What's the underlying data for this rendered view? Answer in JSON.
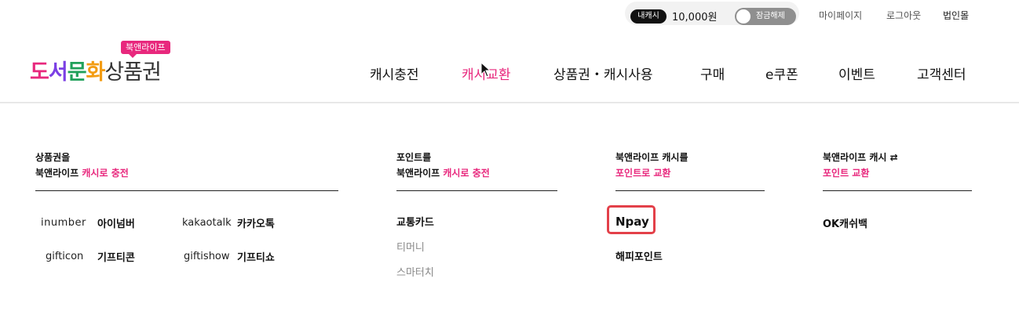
{
  "util": {
    "cash_badge": "내캐시",
    "cash_amount": "10,000원",
    "lock_label": "잠금해제",
    "links": [
      "마이페이지",
      "로그아웃",
      "법인몰"
    ]
  },
  "logo": {
    "tag": "북앤라이프",
    "word1": "도",
    "word2": "서",
    "word3": "문",
    "word4": "화",
    "word5": "상품권"
  },
  "gnb": [
    "캐시충전",
    "캐시교환",
    "상품권・캐시사용",
    "구매",
    "e쿠폰",
    "이벤트",
    "고객센터"
  ],
  "columns": {
    "col1": {
      "line1": "상품권을",
      "line2_black": "북앤라이프 ",
      "line2_pink": "캐시로 충전"
    },
    "col2": {
      "line1": "포인트를",
      "line2_black": "북앤라이프 ",
      "line2_pink": "캐시로 충전"
    },
    "col3": {
      "line1": "북앤라이프 캐시를",
      "line2_pink": "포인트로 교환"
    },
    "col4": {
      "line1": "북앤라이프 캐시 ⇄",
      "line2_pink": "포인트 교환"
    }
  },
  "col1_items": [
    {
      "logo": "inumber",
      "name": "아이넘버"
    },
    {
      "logo": "kakaotalk",
      "name": "카카오톡"
    },
    {
      "logo": "gifticon",
      "name": "기프티콘"
    },
    {
      "logo": "giftishow",
      "name": "기프티쇼"
    }
  ],
  "col2_items": [
    "교통카드",
    "티머니",
    "스마터치"
  ],
  "col3_items": [
    "Npay",
    "해피포인트"
  ],
  "col4_items": [
    "OK캐쉬백"
  ],
  "colors": {
    "accent": "#e8287d",
    "highlight_box": "#e34049"
  }
}
